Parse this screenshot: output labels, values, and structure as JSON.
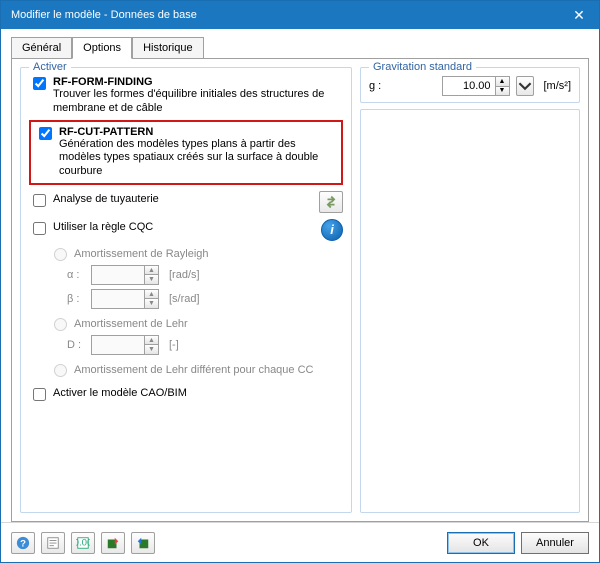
{
  "window": {
    "title": "Modifier le modèle - Données de base"
  },
  "tabs": {
    "general": "Général",
    "options": "Options",
    "history": "Historique"
  },
  "activate": {
    "legend": "Activer",
    "formFinding": {
      "label": "RF-FORM-FINDING",
      "desc": "Trouver les formes d'équilibre initiales des structures de membrane et de câble",
      "checked": true
    },
    "cutPattern": {
      "label": "RF-CUT-PATTERN",
      "desc": "Génération des modèles types plans à partir des modèles types spatiaux créés sur la surface à double courbure",
      "checked": true
    },
    "piping": {
      "label": "Analyse de tuyauterie",
      "checked": false
    },
    "cqc": {
      "label": "Utiliser la règle CQC",
      "checked": false
    },
    "rayleigh": {
      "label": "Amortissement de Rayleigh"
    },
    "alpha": {
      "label": "α :",
      "unit": "[rad/s]"
    },
    "beta": {
      "label": "β :",
      "unit": "[s/rad]"
    },
    "lehr": {
      "label": "Amortissement de Lehr"
    },
    "d": {
      "label": "D :",
      "unit": "[-]"
    },
    "lehrCC": {
      "label": "Amortissement de Lehr différent pour chaque CC"
    },
    "cadbim": {
      "label": "Activer le modèle CAO/BIM",
      "checked": false
    }
  },
  "gravity": {
    "legend": "Gravitation standard",
    "label": "g :",
    "value": "10.00",
    "unit": "[m/s²]"
  },
  "buttons": {
    "ok": "OK",
    "cancel": "Annuler"
  }
}
